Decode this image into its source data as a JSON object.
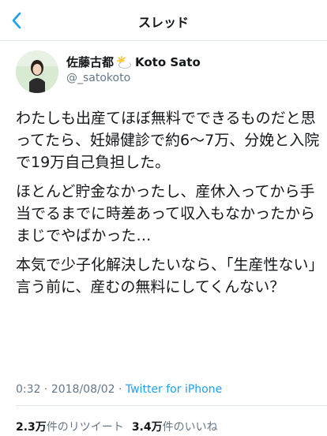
{
  "nav": {
    "title": "スレッド"
  },
  "user": {
    "name": "佐藤古都",
    "name_suffix": "Koto Sato",
    "handle": "@_satokoto"
  },
  "tweet": {
    "paragraphs": [
      "わたしも出産てほぼ無料でできるものだと思ってたら、妊婦健診で約6〜7万、分娩と入院で19万自己負担した。",
      "ほとんど貯金なかったし、産休入ってから手当でるまでに時差あって収入もなかったからまじでやばかった…",
      "本気で少子化解決したいなら、「生産性ない」言う前に、産むの無料にしてくんない？"
    ]
  },
  "meta": {
    "time": "0:32",
    "separator1": "·",
    "date": "2018/08/02",
    "separator2": "·",
    "source": "Twitter for iPhone"
  },
  "stats": {
    "retweets_count": "2.3万",
    "retweets_label": "件のリツイート",
    "likes_count": "3.4万",
    "likes_label": "件のいいね"
  },
  "colors": {
    "accent": "#1da1f2",
    "text": "#14171a",
    "muted": "#657786",
    "border": "#e1e8ed"
  },
  "icons": {
    "back": "chevron-left-icon",
    "emoji": "sun-behind-cloud-icon"
  }
}
